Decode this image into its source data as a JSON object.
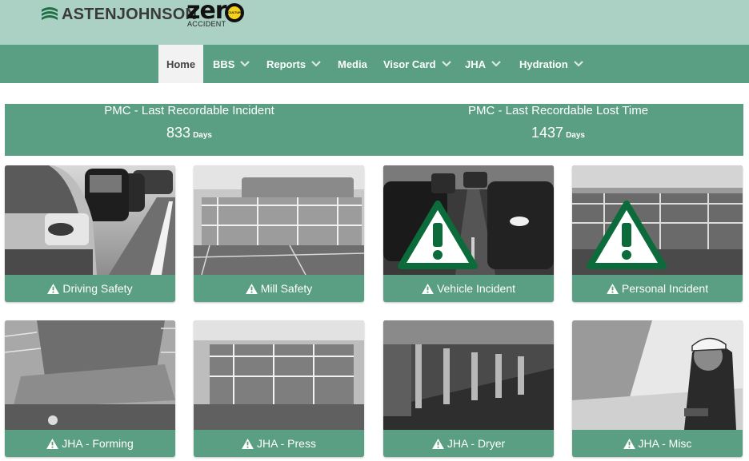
{
  "brand": {
    "name": "ASTENJOHNSON",
    "zero_word": "zer",
    "zero_ring_text": "CULTURE",
    "zero_sub": "ACCIDENT"
  },
  "nav": {
    "items": [
      {
        "label": "Home",
        "active": true,
        "dropdown": false
      },
      {
        "label": "BBS",
        "active": false,
        "dropdown": true
      },
      {
        "label": "Reports",
        "active": false,
        "dropdown": true
      },
      {
        "label": "Media",
        "active": false,
        "dropdown": false
      },
      {
        "label": "Visor Card",
        "active": false,
        "dropdown": true
      },
      {
        "label": "JHA",
        "active": false,
        "dropdown": true
      },
      {
        "label": "Hydration",
        "active": false,
        "dropdown": true
      }
    ]
  },
  "stats": [
    {
      "title": "PMC - Last Recordable Incident",
      "value": "833",
      "unit": "Days"
    },
    {
      "title": "PMC - Last Recordable Lost Time",
      "value": "1437",
      "unit": "Days"
    }
  ],
  "tiles": [
    {
      "label": "Driving Safety",
      "image": "traffic-photo"
    },
    {
      "label": "Mill Safety",
      "image": "paper-mill-photo"
    },
    {
      "label": "Vehicle Incident",
      "image": "traffic-warning-photo"
    },
    {
      "label": "Personal Incident",
      "image": "mill-warning-photo"
    },
    {
      "label": "JHA - Forming",
      "image": "forming-section-photo"
    },
    {
      "label": "JHA - Press",
      "image": "press-section-photo"
    },
    {
      "label": "JHA - Dryer",
      "image": "dryer-section-photo"
    },
    {
      "label": "JHA - Misc",
      "image": "worker-photo"
    }
  ],
  "colors": {
    "header_bg": "#aad1c3",
    "accent_green": "#5a9e84",
    "warning_logo_green": "#0b6b3a",
    "zero_yellow": "#f6d21b"
  },
  "icons": {
    "tile_label_icon": "warning-triangle-icon",
    "dropdown_icon": "chevron-down-icon"
  }
}
